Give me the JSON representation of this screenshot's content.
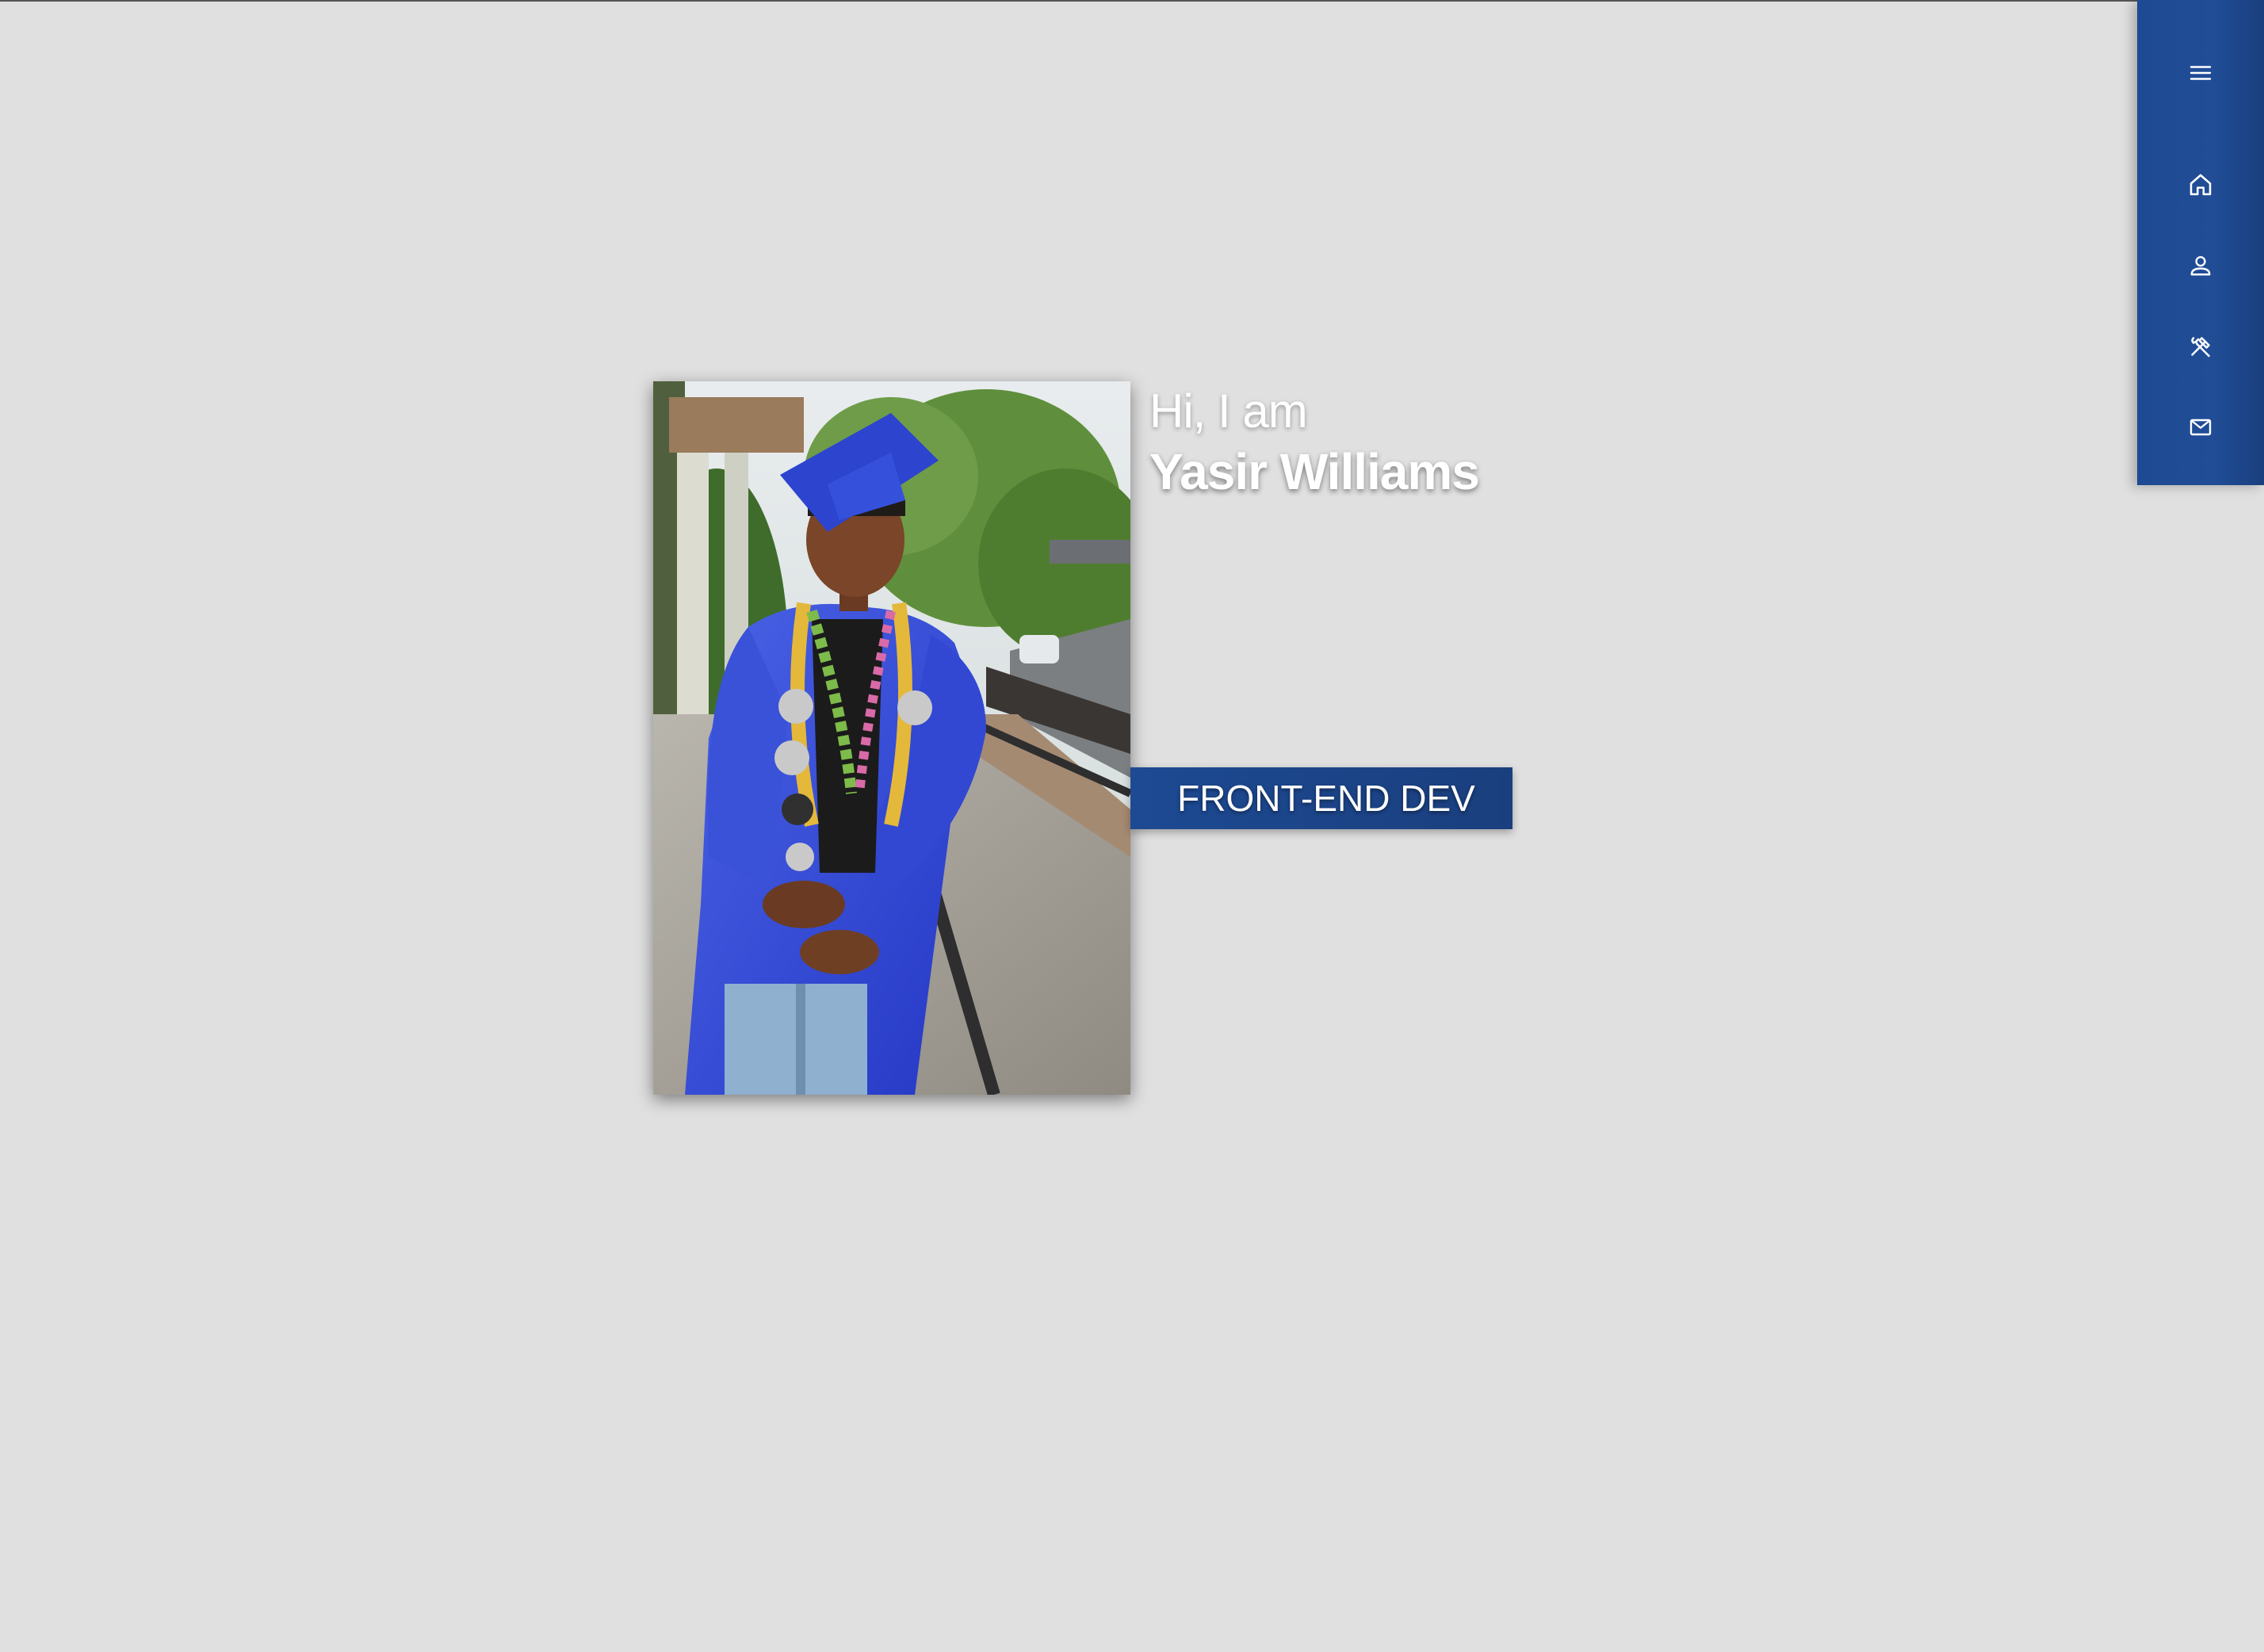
{
  "hero": {
    "greeting": "Hi, I am",
    "name": "Yasir Williams",
    "role": "FRONT-END DEV",
    "photo_description": "graduate-portrait"
  },
  "nav": {
    "items": [
      {
        "id": "menu",
        "icon": "menu-icon"
      },
      {
        "id": "home",
        "icon": "home-icon"
      },
      {
        "id": "about",
        "icon": "person-icon"
      },
      {
        "id": "skills",
        "icon": "tools-icon"
      },
      {
        "id": "contact",
        "icon": "mail-icon"
      }
    ]
  },
  "colors": {
    "background": "#e0e0e0",
    "accent": "#1d4a93",
    "text": "#ffffff"
  }
}
